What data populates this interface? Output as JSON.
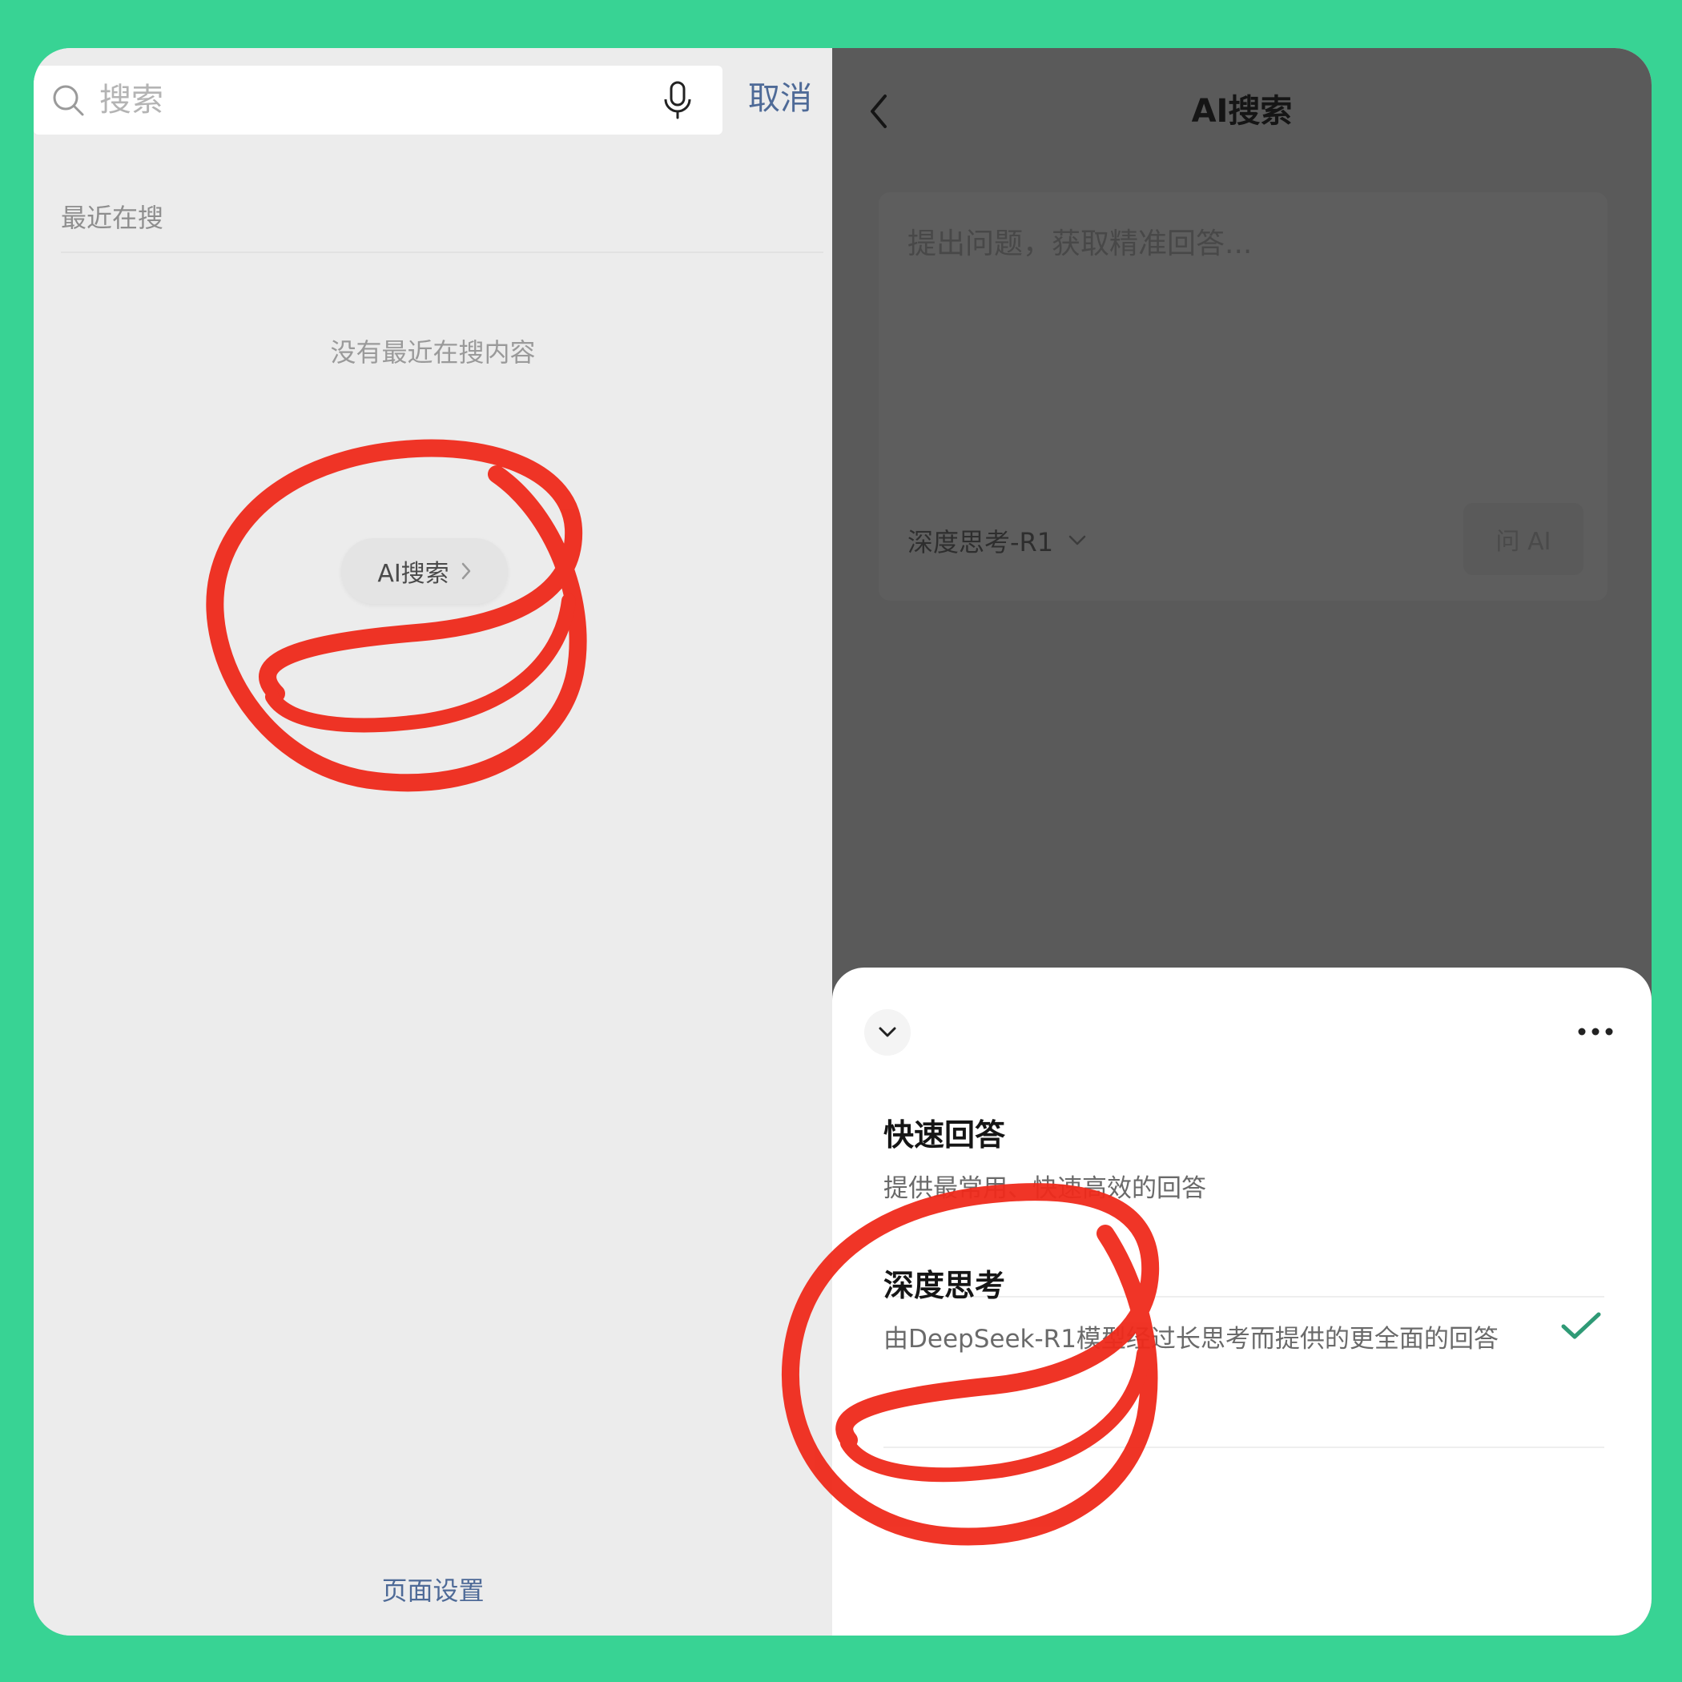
{
  "left_screen": {
    "search": {
      "placeholder": "搜索",
      "cancel_label": "取消",
      "search_icon": "magnifier-icon",
      "voice_icon": "microphone-icon"
    },
    "recent": {
      "title": "最近在搜",
      "empty_text": "没有最近在搜内容"
    },
    "ai_search_entry": {
      "label": "AI搜索",
      "icon": "chevron-right-icon"
    },
    "footer_link": "页面设置"
  },
  "right_screen": {
    "title": "AI搜索",
    "back_icon": "chevron-left-icon",
    "ask_box": {
      "placeholder": "提出问题，获取精准回答...",
      "model_selected": "深度思考-R1",
      "model_icon": "chevron-down-icon",
      "ask_button": "问 AI"
    },
    "model_sheet": {
      "collapse_icon": "chevron-down-icon",
      "more_icon": "more-horizontal-icon",
      "options": [
        {
          "title": "快速回答",
          "description": "提供最常用、快速高效的回答",
          "selected": false
        },
        {
          "title": "深度思考",
          "description": "由DeepSeek-R1模型经过长思考而提供的更全面的回答",
          "selected": true
        }
      ],
      "selected_icon": "checkmark-icon"
    }
  },
  "colors": {
    "background": "#38d394",
    "link_blue": "#4e6a97",
    "overlay": "#5a5a5a",
    "check_green": "#2f9a76",
    "annotation_red": "#ef2a1b"
  }
}
